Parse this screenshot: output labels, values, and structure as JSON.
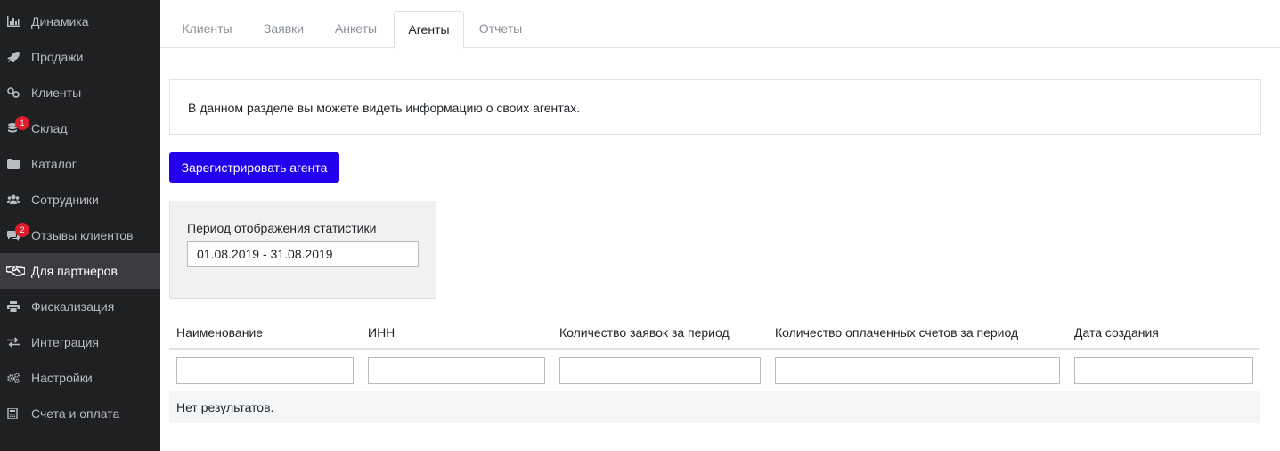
{
  "sidebar": {
    "items": [
      {
        "label": "Динамика",
        "icon": "bar-chart-icon"
      },
      {
        "label": "Продажи",
        "icon": "rocket-icon"
      },
      {
        "label": "Клиенты",
        "icon": "link-icon"
      },
      {
        "label": "Склад",
        "icon": "database-icon",
        "badge": "1"
      },
      {
        "label": "Каталог",
        "icon": "folder-icon"
      },
      {
        "label": "Сотрудники",
        "icon": "users-icon"
      },
      {
        "label": "Отзывы клиентов",
        "icon": "comments-icon",
        "badge": "2"
      },
      {
        "label": "Для партнеров",
        "icon": "handshake-icon",
        "active": true
      },
      {
        "label": "Фискализация",
        "icon": "printer-icon"
      },
      {
        "label": "Интеграция",
        "icon": "exchange-icon"
      },
      {
        "label": "Настройки",
        "icon": "gears-icon"
      },
      {
        "label": "Счета и оплата",
        "icon": "calculator-icon"
      }
    ]
  },
  "tabs": [
    {
      "label": "Клиенты"
    },
    {
      "label": "Заявки"
    },
    {
      "label": "Анкеты"
    },
    {
      "label": "Агенты",
      "active": true
    },
    {
      "label": "Отчеты"
    }
  ],
  "info": {
    "text": "В данном разделе вы можете видеть информацию о своих агентах."
  },
  "actions": {
    "register_label": "Зарегистрировать агента"
  },
  "period": {
    "label": "Период отображения статистики",
    "value": "01.08.2019 - 31.08.2019"
  },
  "table": {
    "columns": [
      "Наименование",
      "ИНН",
      "Количество заявок за период",
      "Количество оплаченных счетов за период",
      "Дата создания"
    ],
    "empty_text": "Нет результатов."
  },
  "colors": {
    "sidebar_bg": "#1f2022",
    "accent_button": "#2200ee",
    "badge": "#dc1b2c"
  }
}
